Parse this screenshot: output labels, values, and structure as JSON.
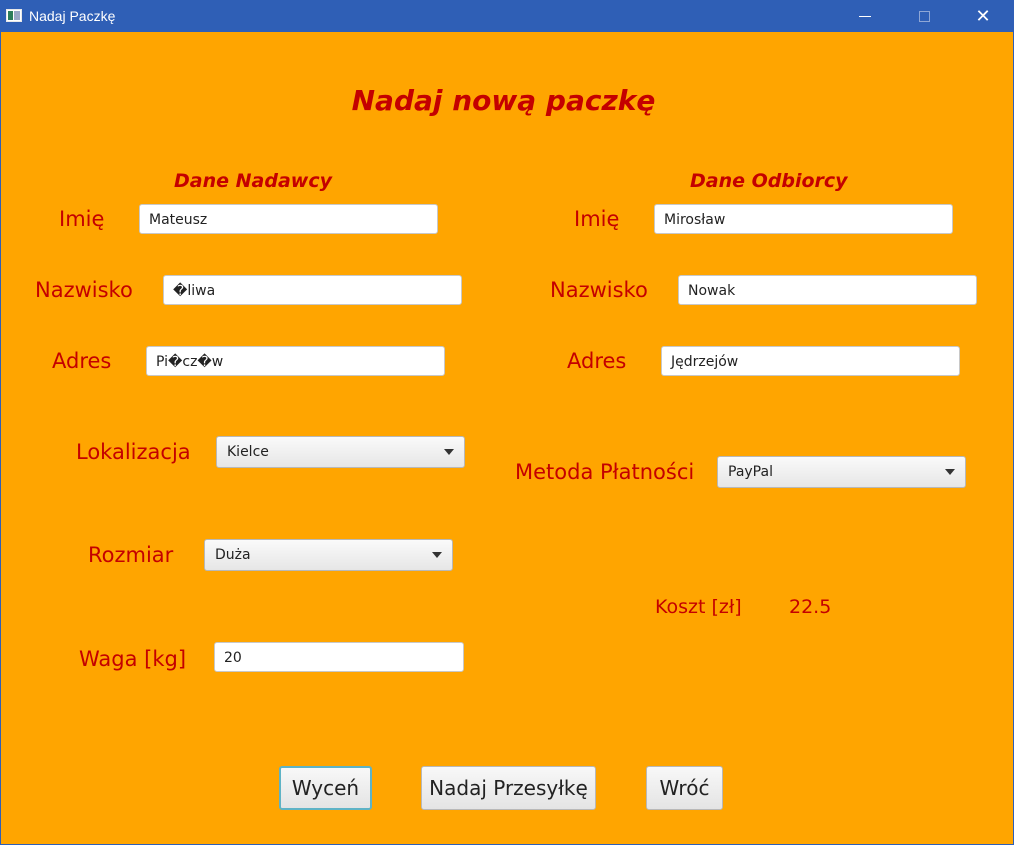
{
  "window": {
    "title": "Nadaj Paczkę"
  },
  "heading": "Nadaj nową paczkę",
  "sender": {
    "title": "Dane Nadawcy",
    "first_name_label": "Imię",
    "first_name": "Mateusz",
    "last_name_label": "Nazwisko",
    "last_name": "�liwa",
    "address_label": "Adres",
    "address": "Pi�cz�w",
    "location_label": "Lokalizacja",
    "location": "Kielce",
    "size_label": "Rozmiar",
    "size": "Duża",
    "weight_label": "Waga [kg]",
    "weight": "20"
  },
  "recipient": {
    "title": "Dane Odbiorcy",
    "first_name_label": "Imię",
    "first_name": "Mirosław",
    "last_name_label": "Nazwisko",
    "last_name": "Nowak",
    "address_label": "Adres",
    "address": "Jędrzejów",
    "payment_label": "Metoda Płatności",
    "payment": "PayPal"
  },
  "cost": {
    "label": "Koszt [zł]",
    "value": "22.5"
  },
  "buttons": {
    "estimate": "Wyceń",
    "send": "Nadaj Przesyłkę",
    "back": "Wróć"
  },
  "icons": {
    "window_icon": "app-window-icon",
    "minimize": "minimize-icon",
    "maximize": "maximize-icon",
    "close": "close-icon",
    "dropdown": "chevron-down-icon"
  },
  "colors": {
    "titlebar": "#2f5fb6",
    "background": "#ffa500",
    "text": "#c40000",
    "focus": "#5eb3c6"
  }
}
